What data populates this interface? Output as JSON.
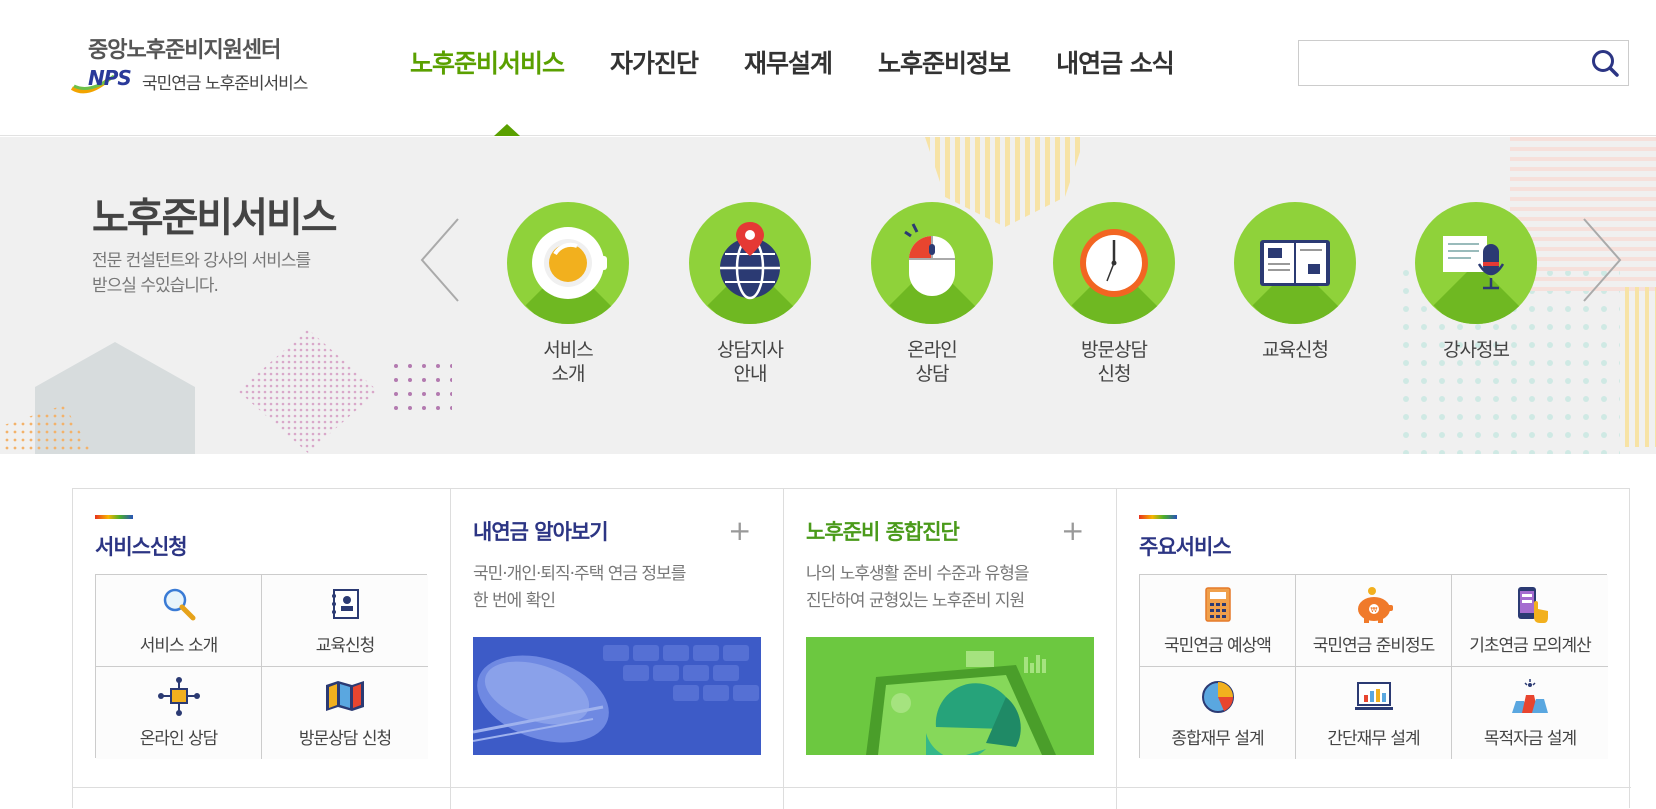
{
  "header": {
    "logo_title": "중앙노후준비지원센터",
    "logo_nps": "NPS",
    "logo_sub": "국민연금 노후준비서비스",
    "nav": [
      {
        "label": "노후준비서비스",
        "active": true
      },
      {
        "label": "자가진단",
        "active": false
      },
      {
        "label": "재무설계",
        "active": false
      },
      {
        "label": "노후준비정보",
        "active": false
      },
      {
        "label": "내연금 소식",
        "active": false
      }
    ],
    "search": {
      "placeholder": "",
      "icon": "search-icon"
    }
  },
  "banner": {
    "title": "노후준비서비스",
    "description": "전문 컨설턴트와 강사의 서비스를\n받으실 수있습니다.",
    "prev_icon": "chevron-left-icon",
    "next_icon": "chevron-right-icon",
    "services": [
      {
        "label": "서비스\n소개",
        "icon": "coffee-cup-icon"
      },
      {
        "label": "상담지사\n안내",
        "icon": "globe-pin-icon"
      },
      {
        "label": "온라인\n상담",
        "icon": "mouse-icon"
      },
      {
        "label": "방문상담\n신청",
        "icon": "clock-icon"
      },
      {
        "label": "교육신청",
        "icon": "book-icon"
      },
      {
        "label": "강사정보",
        "icon": "microphone-icon"
      }
    ]
  },
  "panels": {
    "service_apply": {
      "heading": "서비스신청",
      "items": [
        {
          "label": "서비스 소개",
          "icon": "magnifier-icon"
        },
        {
          "label": "교육신청",
          "icon": "notebook-icon"
        },
        {
          "label": "온라인 상담",
          "icon": "network-icon"
        },
        {
          "label": "방문상담 신청",
          "icon": "map-icon"
        }
      ]
    },
    "my_pension": {
      "heading": "내연금 알아보기",
      "plus": "+",
      "description": "국민·개인·퇴직·주택 연금 정보를\n한 번에 확인"
    },
    "diagnosis": {
      "heading": "노후준비 종합진단",
      "plus": "+",
      "description": "나의 노후생활 준비 수준과 유형을\n진단하여 균형있는 노후준비 지원"
    },
    "main_services": {
      "heading": "주요서비스",
      "items": [
        {
          "label": "국민연금 예상액",
          "icon": "calculator-icon"
        },
        {
          "label": "국민연금 준비정도",
          "icon": "piggy-bank-icon"
        },
        {
          "label": "기초연금 모의계산",
          "icon": "phone-touch-icon"
        },
        {
          "label": "종합재무 설계",
          "icon": "pie-chart-icon"
        },
        {
          "label": "간단재무 설계",
          "icon": "monitor-chart-icon"
        },
        {
          "label": "목적자금 설계",
          "icon": "bags-icon"
        }
      ]
    }
  },
  "colors": {
    "brand_green": "#5aa000",
    "circle_green": "#8fd23a",
    "heading_navy": "#2c3584",
    "banner_bg": "#f0f0f0"
  }
}
